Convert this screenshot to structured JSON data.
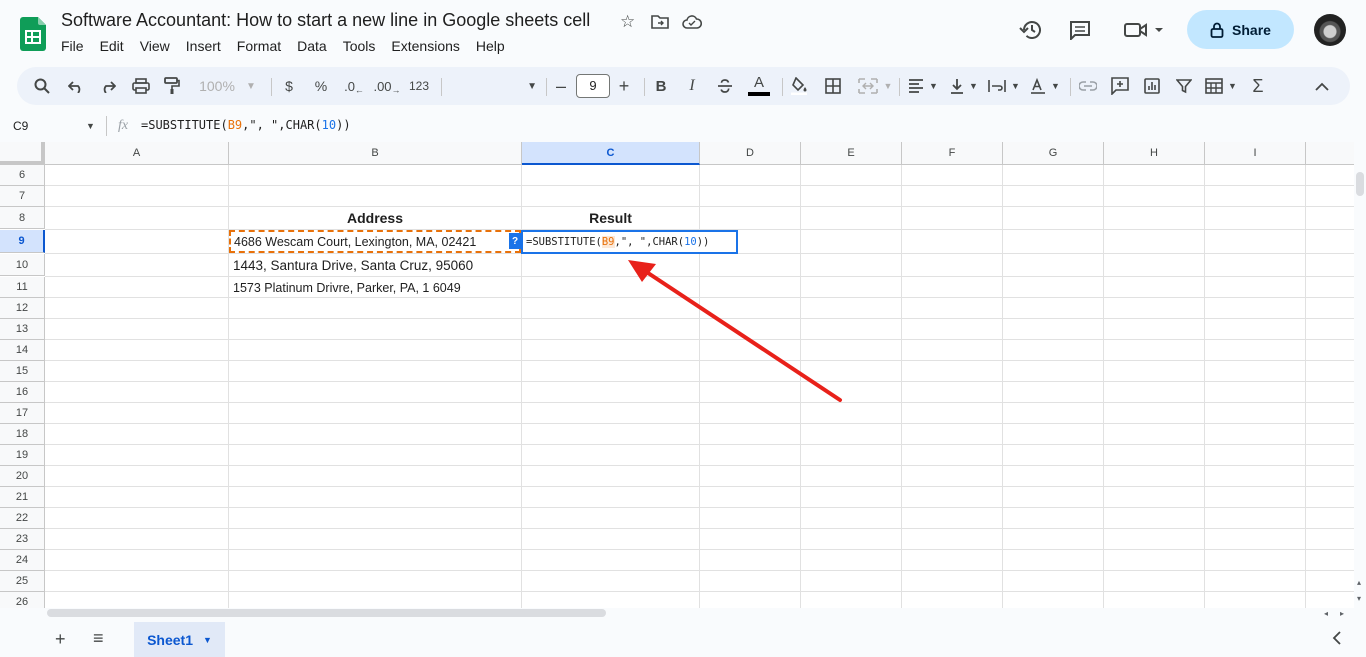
{
  "app": {
    "title": "Software Accountant: How to start a new line in Google sheets cell",
    "menu": [
      "File",
      "Edit",
      "View",
      "Insert",
      "Format",
      "Data",
      "Tools",
      "Extensions",
      "Help"
    ],
    "share_label": "Share"
  },
  "toolbar": {
    "zoom": "100%",
    "currency": "$",
    "percent": "%",
    "dec_decrease": ".0",
    "dec_increase": ".00",
    "number_format": "123",
    "font_size": "9",
    "bold": "B",
    "italic": "I",
    "text_color_glyph": "A",
    "sum_glyph": "Σ"
  },
  "formula_bar": {
    "name_box": "C9",
    "fx_label": "fx",
    "formula_parts": [
      "=SUBSTITUTE(",
      "B9",
      ",\", \",CHAR(",
      "10",
      "))"
    ]
  },
  "grid": {
    "columns": [
      "A",
      "B",
      "C",
      "D",
      "E",
      "F",
      "G",
      "H",
      "I"
    ],
    "selected_column": "C",
    "rows": [
      "6",
      "7",
      "8",
      "9",
      "10",
      "11",
      "12",
      "13",
      "14",
      "15",
      "16",
      "17",
      "18",
      "19",
      "20",
      "21",
      "22",
      "23",
      "24",
      "25",
      "26"
    ],
    "selected_row": "9",
    "cells": {
      "B8": "Address",
      "C8": "Result",
      "B9": "4686 Wescam Court, Lexington, MA, 02421",
      "B10": "1443, Santura Drive, Santa Cruz, 95060",
      "B11": "1573  Platinum Drivre, Parker, PA, 1 6049"
    },
    "editing_cell_parts": [
      "=SUBSTITUTE(",
      "B9",
      ",\", \",CHAR(",
      "10",
      "))"
    ],
    "help_badge": "?"
  },
  "footer": {
    "add_sheet": "+",
    "all_sheets": "≡",
    "sheet_tab": "Sheet1"
  },
  "colors": {
    "accent": "#0b57d0",
    "share_bg": "#c2e7ff",
    "reference": "#e8710a",
    "arrow": "#e8211a"
  }
}
